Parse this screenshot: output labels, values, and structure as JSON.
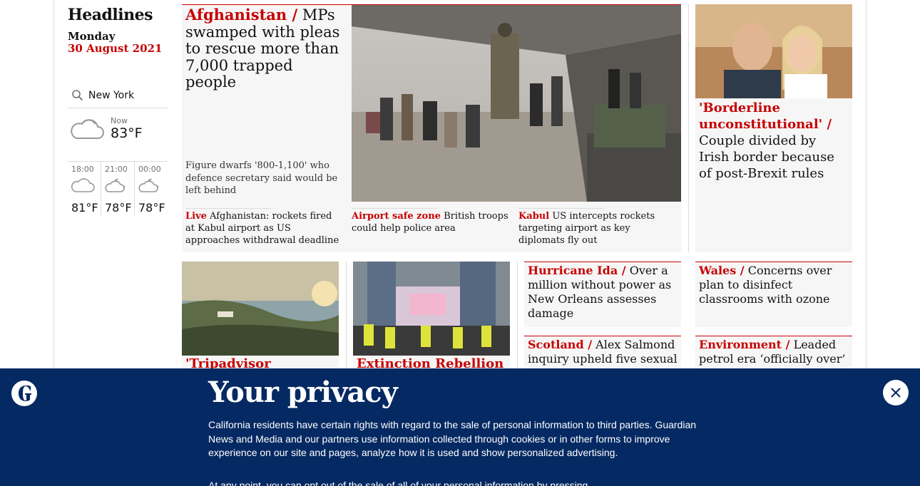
{
  "rail": {
    "title": "Headlines",
    "day": "Monday",
    "date": "30 August 2021"
  },
  "weather": {
    "location": "New York",
    "now_label": "Now",
    "now_temp": "83°F",
    "forecast": [
      {
        "time": "18:00",
        "temp": "81°F",
        "icon": "cloud-icon"
      },
      {
        "time": "21:00",
        "temp": "78°F",
        "icon": "moon-cloud-icon"
      },
      {
        "time": "00:00",
        "temp": "78°F",
        "icon": "moon-cloud-icon"
      }
    ]
  },
  "main_story": {
    "kicker": "Afghanistan /",
    "headline": "MPs swamped with pleas to rescue more than 7,000 trapped people",
    "standfirst": "Figure dwarfs '800-1,100' who defence secretary said would be left behind",
    "sub_links": [
      {
        "kicker": "Live",
        "text": "Afghanistan: rockets fired at Kabul airport as US approaches withdrawal deadline"
      },
      {
        "kicker": "Airport safe zone",
        "text": "British troops could help police area"
      },
      {
        "kicker": "Kabul",
        "text": "US intercepts rockets targeting airport as key diplomats fly out"
      }
    ]
  },
  "right_story": {
    "kicker": "'Borderline unconstitutional' /",
    "headline": "Couple divided by Irish border because of post-Brexit rules"
  },
  "row2": [
    {
      "kicker": "'Tripadvisor warriors'",
      "headline": ""
    },
    {
      "kicker": "Extinction Rebellion /",
      "headline": ""
    }
  ],
  "small_stories": [
    {
      "kicker": "Hurricane Ida /",
      "headline": "Over a million without power as New Orleans assesses damage"
    },
    {
      "kicker": "Wales /",
      "headline": "Concerns over plan to disinfect classrooms with ozone"
    },
    {
      "kicker": "Scotland /",
      "headline": "Alex Salmond inquiry upheld five sexual harassment complaints"
    },
    {
      "kicker": "Environment /",
      "headline": "Leaded petrol era ‘officially over’ as Algeria exhausts supply"
    }
  ],
  "privacy": {
    "title": "Your privacy",
    "text": "California residents have certain rights with regard to the sale of personal information to third parties. Guardian News and Media and our partners use information collected through cookies or in other forms to improve experience on our site and pages, analyze how it is used and show personalized advertising.",
    "text2": "At any point, you can opt out of the sale of all of your personal information by pressing",
    "close_label": "×"
  },
  "colors": {
    "accent": "#c70000",
    "banner": "#052962",
    "card": "#f6f6f6"
  }
}
